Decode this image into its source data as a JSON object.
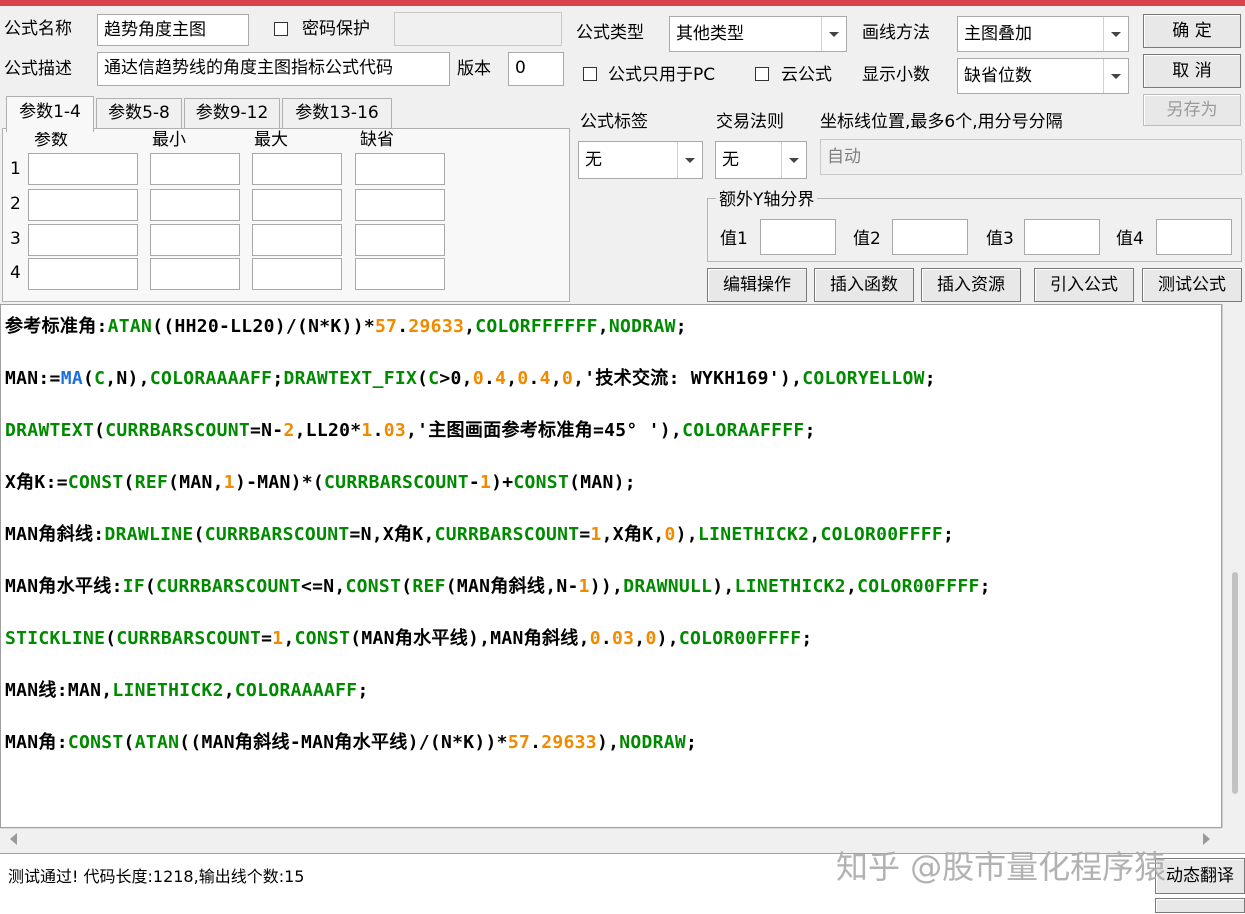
{
  "form": {
    "name_label": "公式名称",
    "name_value": "趋势角度主图",
    "password_label": "密码保护",
    "desc_label": "公式描述",
    "desc_value": "通达信趋势线的角度主图指标公式代码",
    "version_label": "版本",
    "version_value": "0",
    "type_label": "公式类型",
    "type_value": "其他类型",
    "draw_label": "画线方法",
    "draw_value": "主图叠加",
    "pc_only_label": "公式只用于PC",
    "cloud_label": "云公式",
    "decimal_label": "显示小数",
    "decimal_value": "缺省位数",
    "tag_label": "公式标签",
    "tag_value": "无",
    "rule_label": "交易法则",
    "rule_value": "无",
    "coord_label": "坐标线位置,最多6个,用分号分隔",
    "coord_placeholder": "自动",
    "extra_y_label": "额外Y轴分界",
    "v1": "值1",
    "v2": "值2",
    "v3": "值3",
    "v4": "值4"
  },
  "buttons": {
    "ok": "确  定",
    "cancel": "取  消",
    "save_as": "另存为",
    "edit": "编辑操作",
    "insert_func": "插入函数",
    "insert_res": "插入资源",
    "import": "引入公式",
    "test": "测试公式",
    "translate": "动态翻译"
  },
  "tabs": [
    "参数1-4",
    "参数5-8",
    "参数9-12",
    "参数13-16"
  ],
  "params": {
    "headers": [
      "参数",
      "最小",
      "最大",
      "缺省"
    ],
    "rows": [
      "1",
      "2",
      "3",
      "4"
    ]
  },
  "code": [
    [
      [
        "k",
        "参考标准角:"
      ],
      [
        "g",
        "ATAN"
      ],
      [
        "k",
        "(("
      ],
      [
        "k",
        "HH20-LL20"
      ],
      [
        "k",
        ")/("
      ],
      [
        "k",
        "N*K"
      ],
      [
        "k",
        "))*"
      ],
      [
        "o",
        "57"
      ],
      [
        "k",
        "."
      ],
      [
        "o",
        "29633"
      ],
      [
        "k",
        ","
      ],
      [
        "g",
        "COLORFFFFFF"
      ],
      [
        "k",
        ","
      ],
      [
        "g",
        "NODRAW"
      ],
      [
        "k",
        ";"
      ]
    ],
    [
      [
        "k",
        "MAN:="
      ],
      [
        "b",
        "MA"
      ],
      [
        "k",
        "("
      ],
      [
        "g",
        "C"
      ],
      [
        "k",
        ",N),"
      ],
      [
        "g",
        "COLORAAAAFF"
      ],
      [
        "k",
        ";"
      ],
      [
        "g",
        "DRAWTEXT_FIX"
      ],
      [
        "k",
        "("
      ],
      [
        "g",
        "C"
      ],
      [
        "k",
        ">0,"
      ],
      [
        "o",
        "0"
      ],
      [
        "k",
        "."
      ],
      [
        "o",
        "4"
      ],
      [
        "k",
        ","
      ],
      [
        "o",
        "0"
      ],
      [
        "k",
        "."
      ],
      [
        "o",
        "4"
      ],
      [
        "k",
        ","
      ],
      [
        "o",
        "0"
      ],
      [
        "k",
        ",'技术交流: WYKH169'),"
      ],
      [
        "g",
        "COLORYELLOW"
      ],
      [
        "k",
        ";"
      ]
    ],
    [
      [
        "g",
        "DRAWTEXT"
      ],
      [
        "k",
        "("
      ],
      [
        "g",
        "CURRBARSCOUNT"
      ],
      [
        "k",
        "=N-"
      ],
      [
        "o",
        "2"
      ],
      [
        "k",
        ",LL20*"
      ],
      [
        "o",
        "1"
      ],
      [
        "k",
        "."
      ],
      [
        "o",
        "03"
      ],
      [
        "k",
        ",'主图画面参考标准角=45° '),"
      ],
      [
        "g",
        "COLORAAFFFF"
      ],
      [
        "k",
        ";"
      ]
    ],
    [
      [
        "k",
        "X角K:="
      ],
      [
        "g",
        "CONST"
      ],
      [
        "k",
        "("
      ],
      [
        "g",
        "REF"
      ],
      [
        "k",
        "(MAN,"
      ],
      [
        "o",
        "1"
      ],
      [
        "k",
        ")-MAN)*("
      ],
      [
        "g",
        "CURRBARSCOUNT"
      ],
      [
        "k",
        "-"
      ],
      [
        "o",
        "1"
      ],
      [
        "k",
        ")+"
      ],
      [
        "g",
        "CONST"
      ],
      [
        "k",
        "(MAN);"
      ]
    ],
    [
      [
        "k",
        "MAN角斜线:"
      ],
      [
        "g",
        "DRAWLINE"
      ],
      [
        "k",
        "("
      ],
      [
        "g",
        "CURRBARSCOUNT"
      ],
      [
        "k",
        "=N,X角K,"
      ],
      [
        "g",
        "CURRBARSCOUNT"
      ],
      [
        "k",
        "="
      ],
      [
        "o",
        "1"
      ],
      [
        "k",
        ",X角K,"
      ],
      [
        "o",
        "0"
      ],
      [
        "k",
        "),"
      ],
      [
        "g",
        "LINETHICK2"
      ],
      [
        "k",
        ","
      ],
      [
        "g",
        "COLOR00FFFF"
      ],
      [
        "k",
        ";"
      ]
    ],
    [
      [
        "k",
        "MAN角水平线:"
      ],
      [
        "g",
        "IF"
      ],
      [
        "k",
        "("
      ],
      [
        "g",
        "CURRBARSCOUNT"
      ],
      [
        "k",
        "<=N,"
      ],
      [
        "g",
        "CONST"
      ],
      [
        "k",
        "("
      ],
      [
        "g",
        "REF"
      ],
      [
        "k",
        "(MAN角斜线,N-"
      ],
      [
        "o",
        "1"
      ],
      [
        "k",
        ")),"
      ],
      [
        "g",
        "DRAWNULL"
      ],
      [
        "k",
        "),"
      ],
      [
        "g",
        "LINETHICK2"
      ],
      [
        "k",
        ","
      ],
      [
        "g",
        "COLOR00FFFF"
      ],
      [
        "k",
        ";"
      ]
    ],
    [
      [
        "g",
        "STICKLINE"
      ],
      [
        "k",
        "("
      ],
      [
        "g",
        "CURRBARSCOUNT"
      ],
      [
        "k",
        "="
      ],
      [
        "o",
        "1"
      ],
      [
        "k",
        ","
      ],
      [
        "g",
        "CONST"
      ],
      [
        "k",
        "(MAN角水平线),MAN角斜线,"
      ],
      [
        "o",
        "0"
      ],
      [
        "k",
        "."
      ],
      [
        "o",
        "03"
      ],
      [
        "k",
        ","
      ],
      [
        "o",
        "0"
      ],
      [
        "k",
        "),"
      ],
      [
        "g",
        "COLOR00FFFF"
      ],
      [
        "k",
        ";"
      ]
    ],
    [
      [
        "k",
        "MAN线:MAN,"
      ],
      [
        "g",
        "LINETHICK2"
      ],
      [
        "k",
        ","
      ],
      [
        "g",
        "COLORAAAAFF"
      ],
      [
        "k",
        ";"
      ]
    ],
    [
      [
        "k",
        "MAN角:"
      ],
      [
        "g",
        "CONST"
      ],
      [
        "k",
        "("
      ],
      [
        "g",
        "ATAN"
      ],
      [
        "k",
        "((MAN角斜线-MAN角水平线)/(N*K))*"
      ],
      [
        "o",
        "57"
      ],
      [
        "k",
        "."
      ],
      [
        "o",
        "29633"
      ],
      [
        "k",
        "),"
      ],
      [
        "g",
        "NODRAW"
      ],
      [
        "k",
        ";"
      ]
    ]
  ],
  "status_text": "测试通过! 代码长度:1218,输出线个数:15",
  "watermark": "知乎 @股市量化程序猿",
  "colors": {
    "green": "#008a00",
    "orange": "#f28a00",
    "blue": "#1b6fe0",
    "accent": "#d9434b"
  }
}
